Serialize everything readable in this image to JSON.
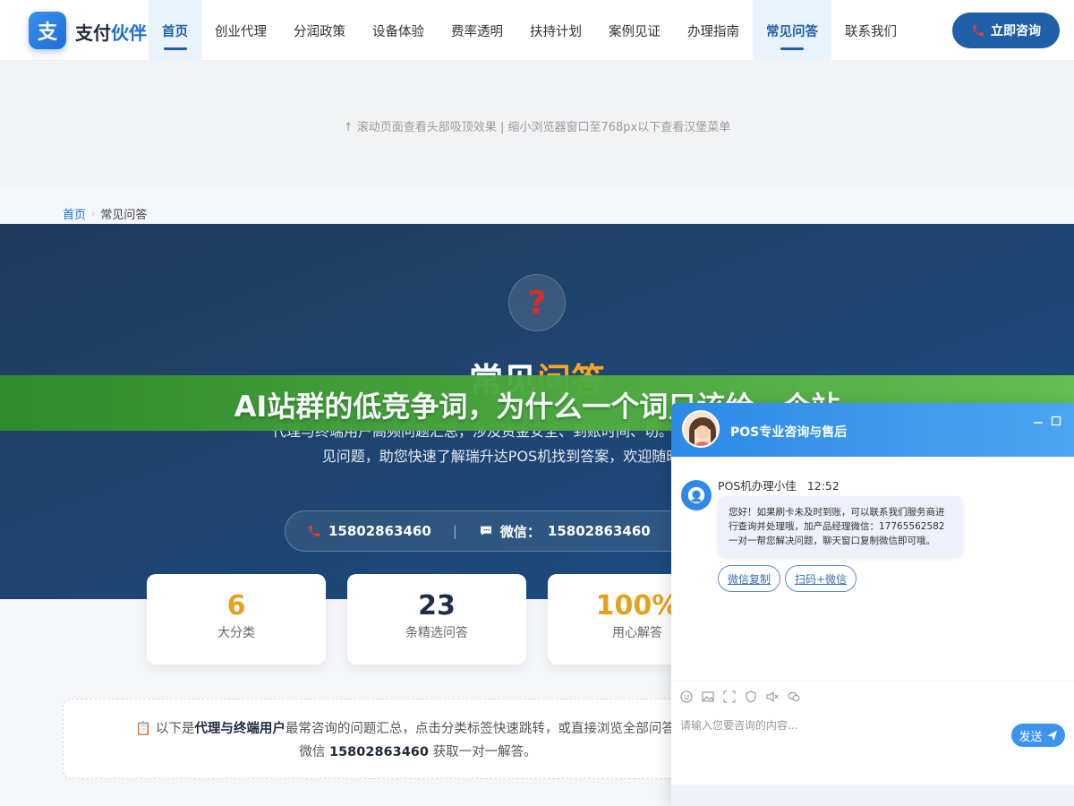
{
  "header": {
    "logo_mark": "支",
    "logo_text_main": "支付",
    "logo_text_accent": "伙伴",
    "nav": [
      {
        "label": "首页",
        "active": true
      },
      {
        "label": "创业代理",
        "active": false
      },
      {
        "label": "分润政策",
        "active": false
      },
      {
        "label": "设备体验",
        "active": false
      },
      {
        "label": "费率透明",
        "active": false
      },
      {
        "label": "扶持计划",
        "active": false
      },
      {
        "label": "案例见证",
        "active": false
      },
      {
        "label": "办理指南",
        "active": false
      },
      {
        "label": "常见问答",
        "active": true
      },
      {
        "label": "联系我们",
        "active": false
      }
    ],
    "consult_label": "立即咨询"
  },
  "tip": "↑ 滚动页面查看头部吸顶效果 | 缩小浏览器窗口至768px以下查看汉堡菜单",
  "breadcrumb": {
    "home": "首页",
    "separator": "›",
    "current": "常见问答"
  },
  "hero": {
    "icon": "?",
    "title_main": "常见",
    "title_highlight": "问答",
    "desc": "代理与终端用户高频问题汇总，涉及资金安全、到账时间、切。我们整理了六大类常见问题，助您快速了解瑞升达POS机找到答案，欢迎随时联系我们。",
    "phone": "15802863460",
    "wechat_label": "微信：",
    "wechat": "15802863460",
    "third_label": "("
  },
  "stats": [
    {
      "value": "6",
      "label": "大分类",
      "color": "#e5a11d"
    },
    {
      "value": "23",
      "label": "条精选问答",
      "color": "#1e2e4a"
    },
    {
      "value": "100%",
      "label": "用心解答",
      "color": "#e5a11d"
    }
  ],
  "notice": {
    "icon": "📋",
    "prefix": "以下是",
    "bold": "代理与终端用户",
    "text": "最常咨询的问题汇总，点击分类标签快速跳转，或直接浏览全部问答。如",
    "line2_prefix": "微信 ",
    "line2_bold": "15802863460",
    "line2_suffix": " 获取一对一解答。"
  },
  "banner": "AI站群的低竞争词，为什么一个词只该给一个站",
  "chat": {
    "title": "POS专业咨询与售后",
    "sender": "POS机办理小佳",
    "time": "12:52",
    "message": "您好！如果刷卡未及时到账，可以联系我们服务商进行查询并处理哦，加产品经理微信：17765562582 一对一帮您解决问题，聊天窗口复制微信即可哦。",
    "actions": [
      "微信复制",
      "扫码+微信"
    ],
    "placeholder": "请输入您要咨询的内容...",
    "send": "发送"
  },
  "colors": {
    "brand": "#1f5fa8",
    "accent": "#f5a623",
    "banner_green": "#4fac3f",
    "chat_blue": "#2d8ae6"
  }
}
